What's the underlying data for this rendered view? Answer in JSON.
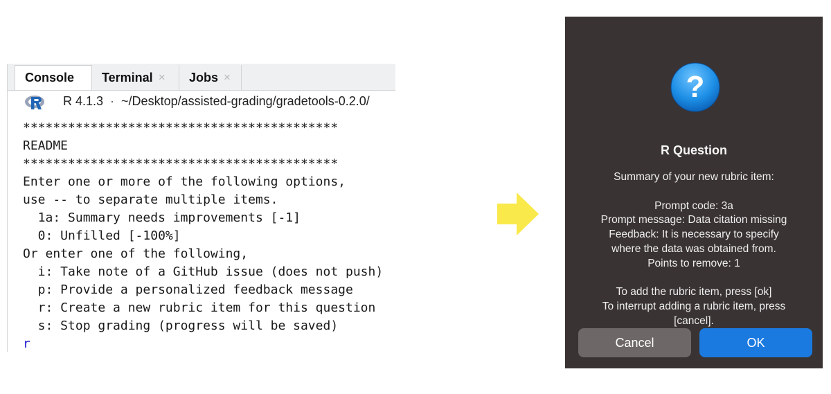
{
  "console": {
    "tabs": [
      {
        "label": "Console",
        "closable": false
      },
      {
        "label": "Terminal",
        "closable": true,
        "close": "×"
      },
      {
        "label": "Jobs",
        "closable": true,
        "close": "×"
      }
    ],
    "r_version": "R 4.1.3",
    "separator": "·",
    "path": "~/Desktop/assisted-grading/gradetools-0.2.0/",
    "lines": [
      "******************************************",
      "README",
      "******************************************",
      "Enter one or more of the following options,",
      "use -- to separate multiple items.",
      "  1a: Summary needs improvements [-1]",
      "  0: Unfilled [-100%]",
      "Or enter one of the following,",
      "  i: Take note of a GitHub issue (does not push)",
      "  p: Provide a personalized feedback message",
      "  r: Create a new rubric item for this question",
      "  s: Stop grading (progress will be saved)"
    ],
    "prompt_input": "r"
  },
  "arrow": {
    "icon": "right-arrow-icon",
    "color": "#f9e94a"
  },
  "dialog": {
    "icon": "question-mark-icon",
    "icon_glyph": "?",
    "title": "R Question",
    "lines": [
      "Summary of your new rubric item:",
      "",
      "Prompt code: 3a",
      "Prompt message: Data citation missing",
      "Feedback: It is necessary to specify",
      "where the data was obtained from.",
      "Points to remove: 1",
      "",
      "To add the rubric item, press [ok]",
      "To interrupt adding a rubric item, press",
      "[cancel]."
    ],
    "cancel_label": "Cancel",
    "ok_label": "OK"
  }
}
